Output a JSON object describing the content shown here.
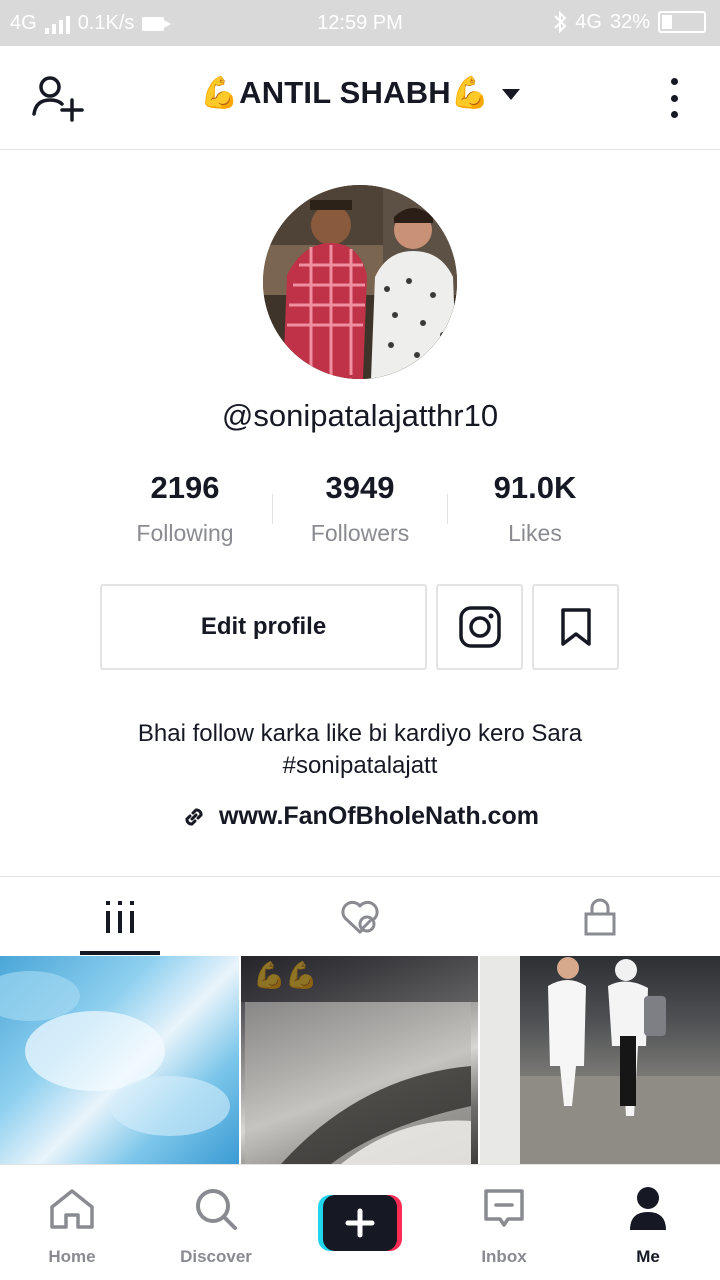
{
  "status_bar": {
    "network_left": "4G",
    "speed": "0.1K/s",
    "time": "12:59 PM",
    "network_right": "4G",
    "battery": "32%"
  },
  "header": {
    "title": "💪ANTIL SHABH💪"
  },
  "profile": {
    "username": "@sonipatalajatthr10",
    "stats": [
      {
        "value": "2196",
        "label": "Following"
      },
      {
        "value": "3949",
        "label": "Followers"
      },
      {
        "value": "91.0K",
        "label": "Likes"
      }
    ],
    "edit_profile_label": "Edit profile",
    "bio_line1": "Bhai follow karka like bi kardiyo kero Sara",
    "bio_line2": "#sonipatalajatt",
    "link": "www.FanOfBholeNath.com"
  },
  "thumbnails": {
    "t2_caption": "💪💪"
  },
  "bottom_nav": [
    {
      "label": "Home"
    },
    {
      "label": "Discover"
    },
    {
      "label": "Inbox"
    },
    {
      "label": "Me"
    }
  ],
  "colors": {
    "text": "#161823",
    "muted": "#8a8b91",
    "border": "#e3e3e4",
    "create_left": "#20d5ec",
    "create_right": "#fe2c55"
  }
}
